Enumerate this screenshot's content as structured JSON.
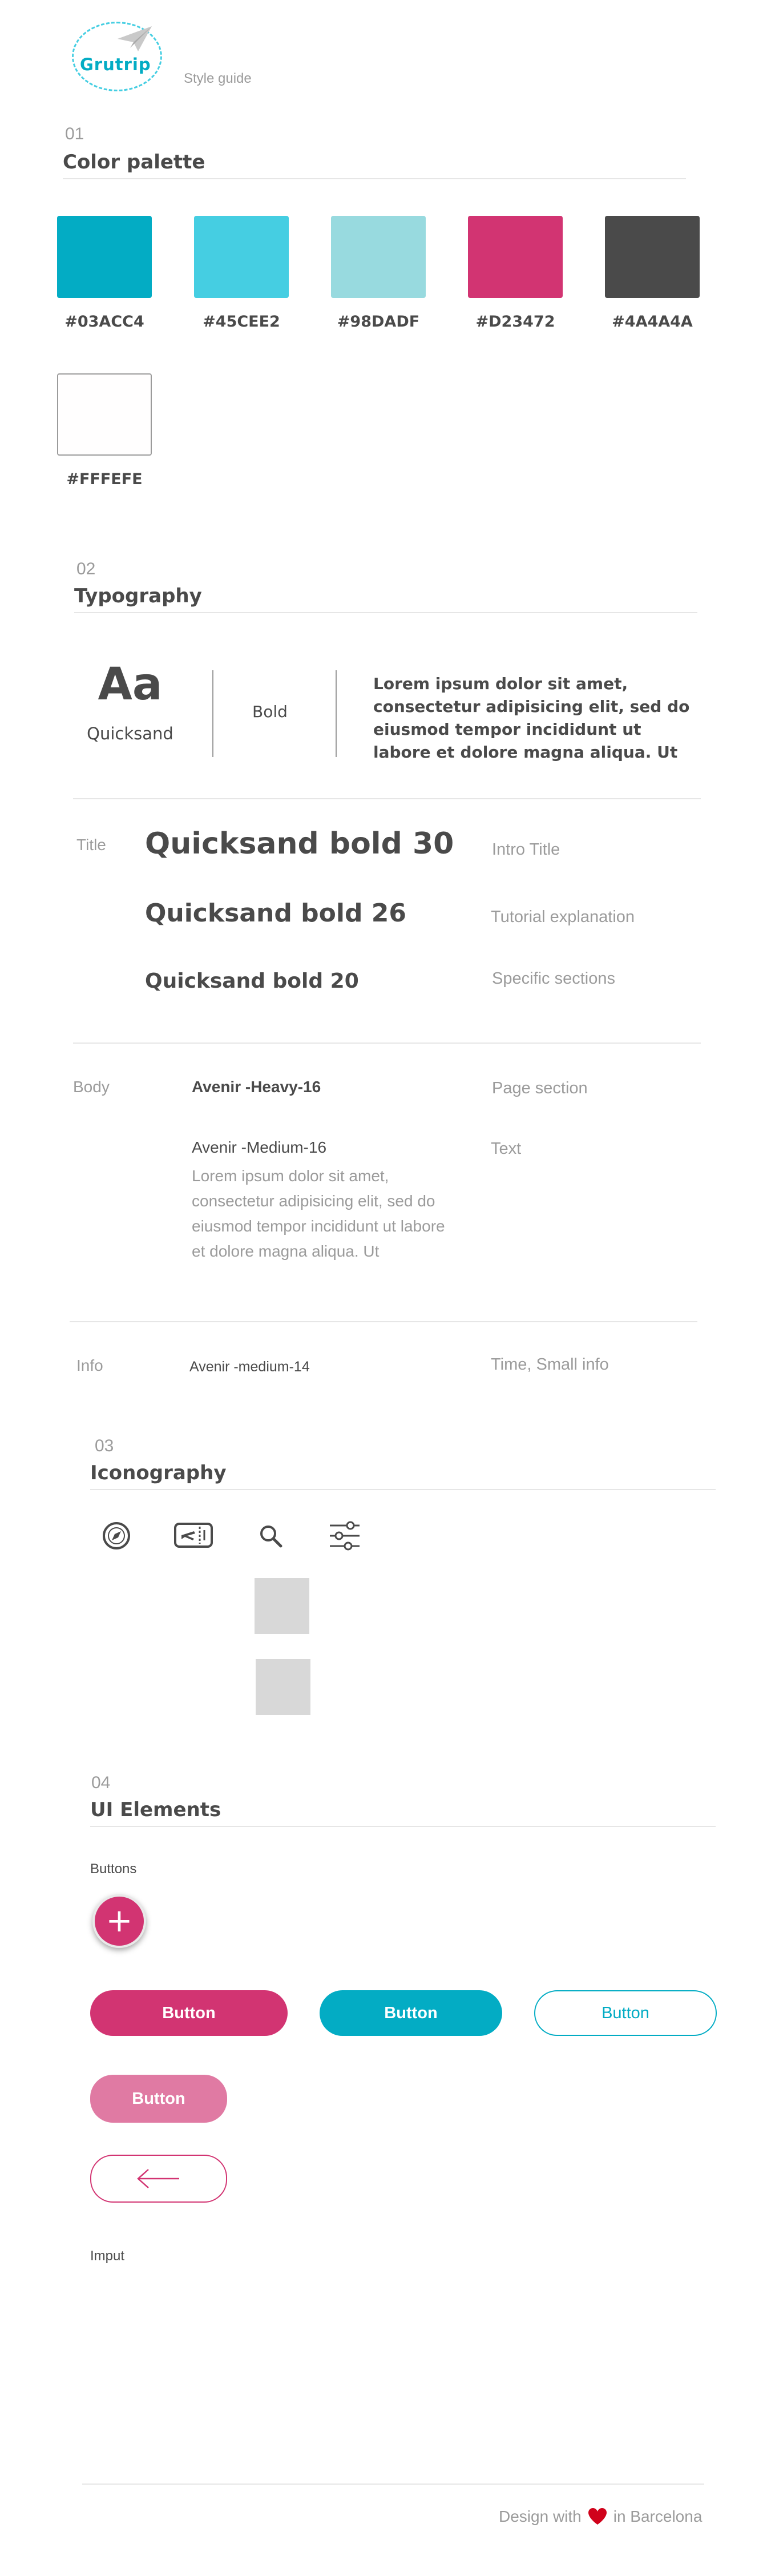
{
  "header": {
    "logo_text": "Grutrip",
    "subtitle": "Style guide"
  },
  "color_section": {
    "number": "01",
    "title": "Color palette",
    "swatches": [
      {
        "hex": "#03ACC4",
        "color": "#03acc4"
      },
      {
        "hex": "#45CEE2",
        "color": "#45cee2"
      },
      {
        "hex": "#98DADF",
        "color": "#98dadf"
      },
      {
        "hex": "#D23472",
        "color": "#d23472"
      },
      {
        "hex": "#4A4A4A",
        "color": "#4a4a4a"
      },
      {
        "hex": "#FFFEFE",
        "color": "#fffefe"
      }
    ]
  },
  "typography": {
    "number": "02",
    "title": "Typography",
    "sample_glyph": "Aa",
    "font_name": "Quicksand",
    "weight": "Bold",
    "lorem": "Lorem ipsum dolor sit amet, consectetur adipisicing elit, sed do eiusmod tempor incididunt ut labore et dolore magna aliqua. Ut",
    "title_label": "Title",
    "titles": [
      {
        "sample": "Quicksand bold 30",
        "usage": "Intro Title"
      },
      {
        "sample": "Quicksand bold 26",
        "usage": "Tutorial explanation"
      },
      {
        "sample": "Quicksand bold 20",
        "usage": "Specific sections"
      }
    ],
    "body_label": "Body",
    "body_heavy": "Avenir -Heavy-16",
    "body_heavy_usage": "Page section",
    "body_medium": "Avenir -Medium-16",
    "body_medium_usage": "Text",
    "body_lorem": "Lorem ipsum dolor sit amet, consectetur adipisicing elit, sed do eiusmod tempor incididunt ut labore et dolore magna aliqua. Ut",
    "info_label": "Info",
    "info_sample": "Avenir -medium-14",
    "info_usage": "Time, Small info"
  },
  "iconography": {
    "number": "03",
    "title": "Iconography",
    "icons": [
      "compass-icon",
      "boarding-pass-icon",
      "search-icon",
      "filter-sliders-icon"
    ]
  },
  "ui_elements": {
    "number": "04",
    "title": "UI Elements",
    "buttons_label": "Buttons",
    "fab_symbol": "+",
    "button_label": "Button",
    "input_label": "Imput",
    "colors": {
      "primary": "#d23472",
      "secondary": "#03acc4",
      "light_primary": "#e07aa3"
    }
  },
  "footer": {
    "prefix": "Design with",
    "suffix": "in Barcelona",
    "heart_color": "#d0021b"
  }
}
